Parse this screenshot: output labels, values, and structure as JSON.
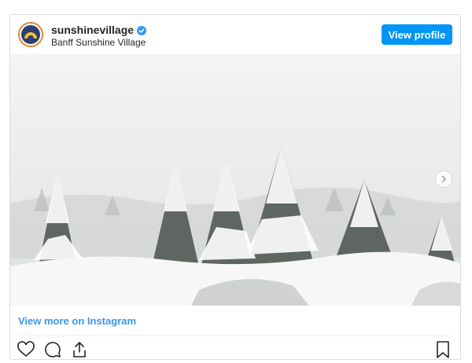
{
  "post": {
    "username": "sunshinevillage",
    "location": "Banff Sunshine Village",
    "view_profile_label": "View profile",
    "view_more_label": "View more on Instagram"
  },
  "icons": {
    "verified": "verified-badge-icon",
    "next": "chevron-right-icon",
    "like": "heart-icon",
    "comment": "comment-icon",
    "share": "share-icon",
    "save": "bookmark-icon"
  },
  "colors": {
    "accent": "#0095f6",
    "link": "#3897f0",
    "avatar_ring": "#e08a3c",
    "avatar_fill": "#2d3f73"
  }
}
